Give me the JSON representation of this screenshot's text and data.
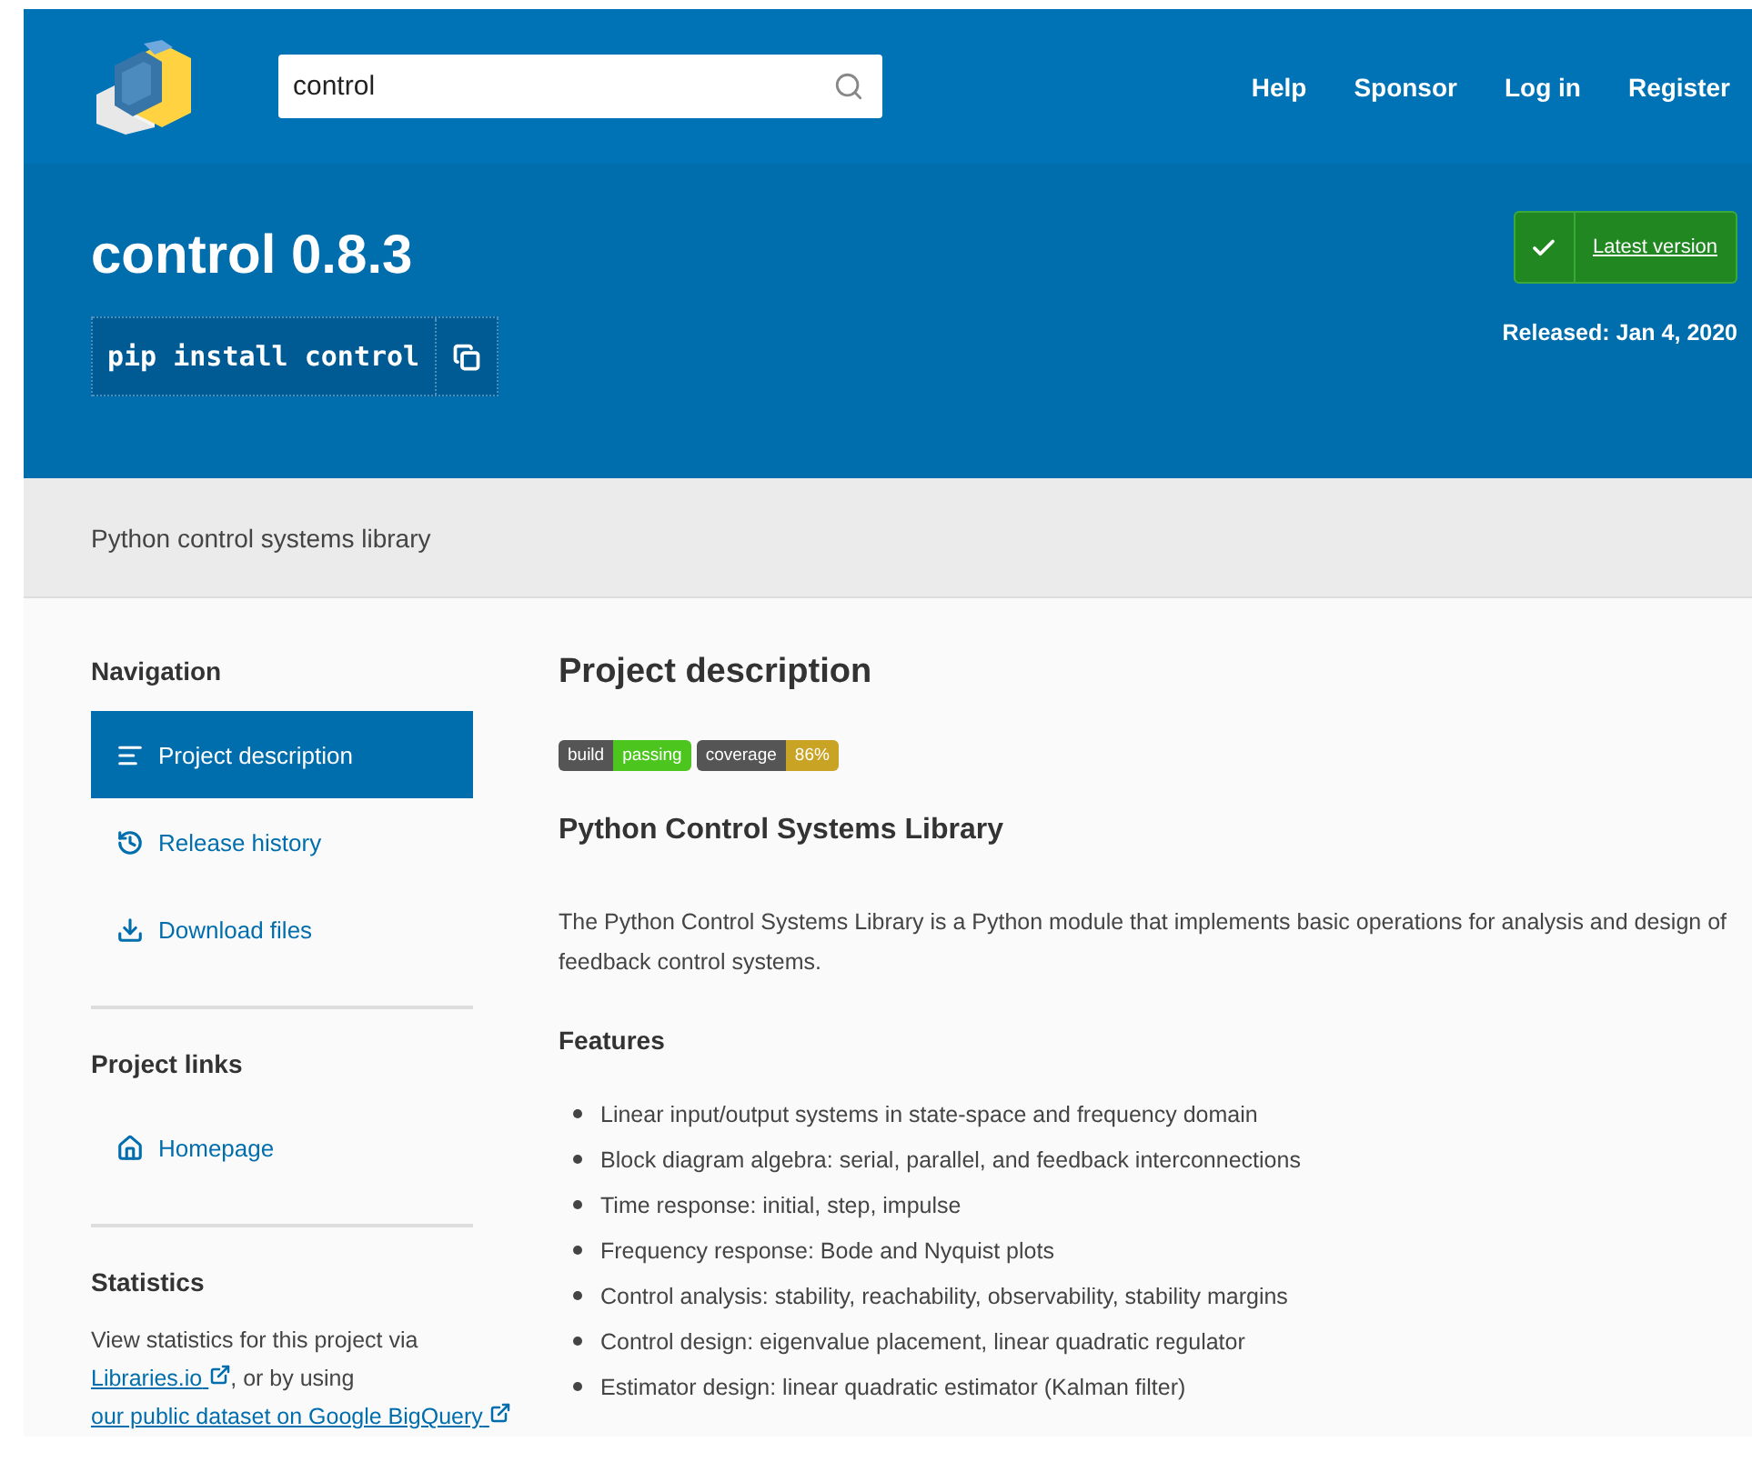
{
  "header": {
    "search": {
      "value": "control"
    },
    "nav_links": [
      "Help",
      "Sponsor",
      "Log in",
      "Register"
    ]
  },
  "banner": {
    "title": "control 0.8.3",
    "install_command": "pip install control",
    "latest_version": "Latest version",
    "released": "Released: Jan 4, 2020"
  },
  "summary": "Python control systems library",
  "sidebar": {
    "sections": [
      {
        "title": "Navigation",
        "items": [
          {
            "label": "Project description",
            "kind": "description",
            "selected": true
          },
          {
            "label": "Release history",
            "kind": "history",
            "selected": false
          },
          {
            "label": "Download files",
            "kind": "download",
            "selected": false
          }
        ]
      },
      {
        "title": "Project links",
        "items": [
          {
            "label": "Homepage",
            "kind": "home",
            "selected": false
          }
        ]
      }
    ],
    "statistics": {
      "title": "Statistics",
      "parts": [
        {
          "kind": "text",
          "text": "View statistics for this project via "
        },
        {
          "kind": "link",
          "text": "Libraries.io"
        },
        {
          "kind": "text",
          "text": ", or by using "
        },
        {
          "kind": "link",
          "text": "our public dataset on Google BigQuery"
        }
      ]
    }
  },
  "main": {
    "title": "Project description",
    "badges": [
      {
        "label": "build",
        "value": "passing",
        "color": "#4cc61e"
      },
      {
        "label": "coverage",
        "value": "86%",
        "color": "#c9a323"
      }
    ],
    "heading": "Python Control Systems Library",
    "intro": "The Python Control Systems Library is a Python module that implements basic operations for analysis and design of feedback control systems.",
    "features_title": "Features",
    "features": [
      "Linear input/output systems in state-space and frequency domain",
      "Block diagram algebra: serial, parallel, and feedback interconnections",
      "Time response: initial, step, impulse",
      "Frequency response: Bode and Nyquist plots",
      "Control analysis: stability, reachability, observability, stability margins",
      "Control design: eigenvalue placement, linear quadratic regulator",
      "Estimator design: linear quadratic estimator (Kalman filter)"
    ]
  }
}
